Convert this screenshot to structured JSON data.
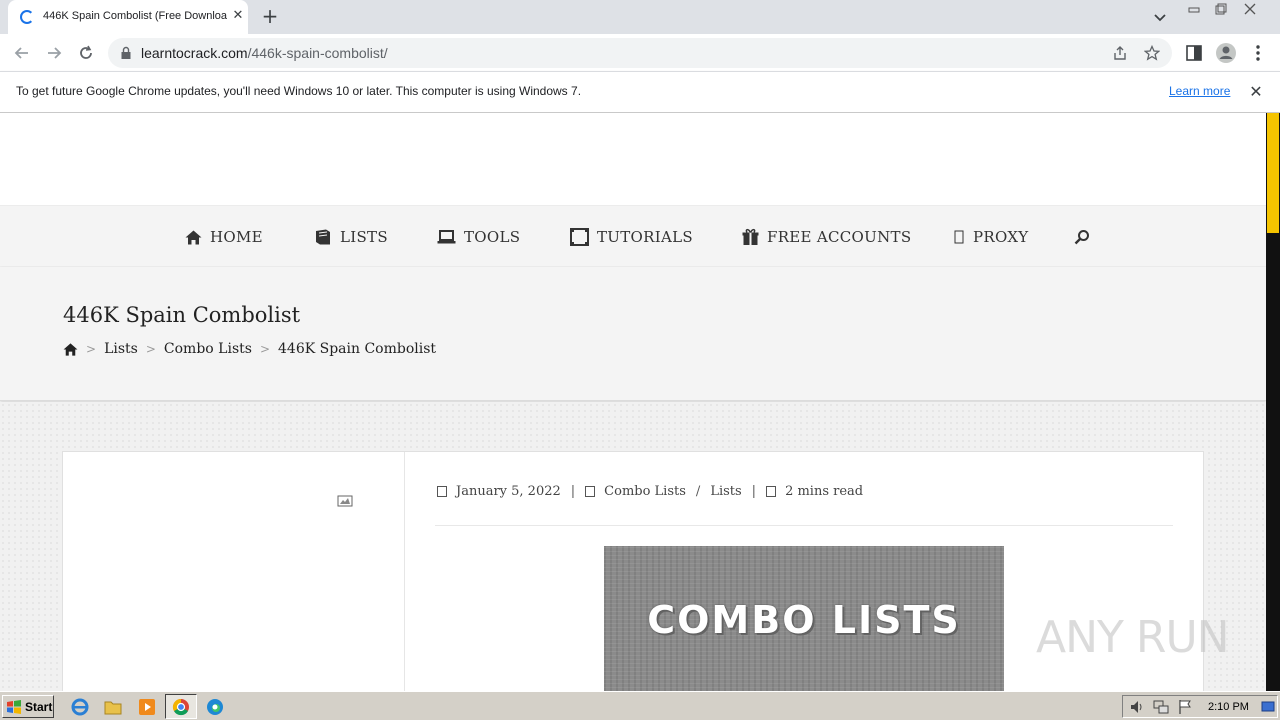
{
  "browser": {
    "tab_title": "446K Spain Combolist (Free Downloa",
    "url_domain": "learntocrack.com",
    "url_path": "/446k-spain-combolist/"
  },
  "infobar": {
    "message": "To get future Google Chrome updates, you'll need Windows 10 or later. This computer is using Windows 7.",
    "link": "Learn more"
  },
  "nav": {
    "items": [
      {
        "label": "HOME",
        "icon": "home-icon"
      },
      {
        "label": "LISTS",
        "icon": "book-icon"
      },
      {
        "label": "TOOLS",
        "icon": "laptop-icon"
      },
      {
        "label": "TUTORIALS",
        "icon": "film-icon"
      },
      {
        "label": "FREE ACCOUNTS",
        "icon": "gift-icon"
      },
      {
        "label": "PROXY",
        "icon": "box-icon"
      }
    ],
    "search_icon": "search-icon"
  },
  "page": {
    "title": "446K Spain Combolist",
    "breadcrumbs": [
      "Lists",
      "Combo Lists",
      "446K Spain Combolist"
    ],
    "breadcrumb_sep": ">"
  },
  "post": {
    "date": "January 5, 2022",
    "category_1": "Combo Lists",
    "category_sep": "/",
    "category_2": "Lists",
    "read_time": "2 mins read",
    "meta_sep": "|",
    "featured_text": "COMBO LISTS"
  },
  "watermark": "ANY RUN",
  "taskbar": {
    "start_label": "Start",
    "clock": "2:10 PM"
  },
  "colors": {
    "accent_scroll": "#f5c400",
    "link": "#1a73e8"
  }
}
